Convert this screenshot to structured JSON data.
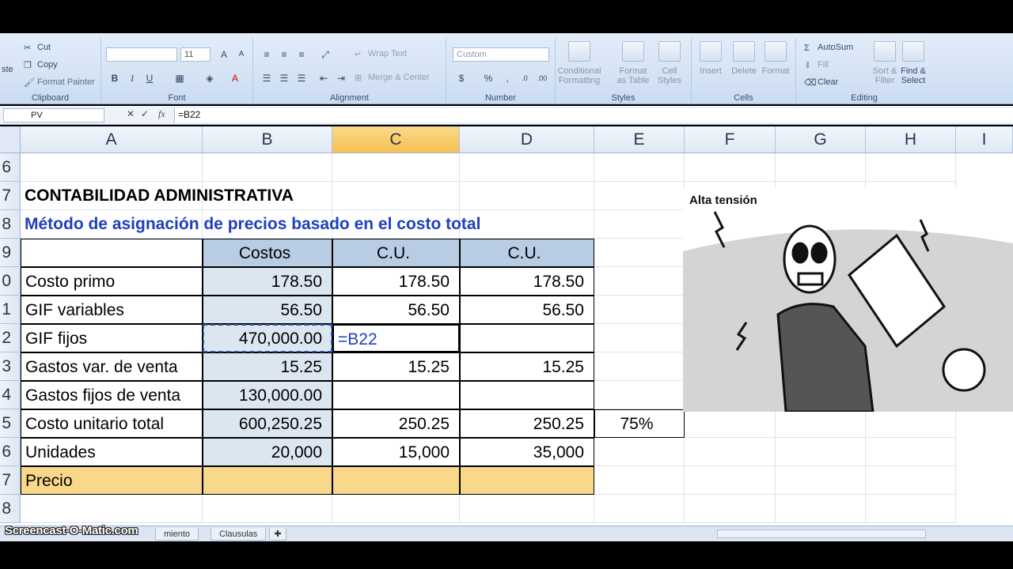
{
  "ribbon": {
    "clipboard": {
      "paste_label": "ste",
      "cut": "Cut",
      "copy": "Copy",
      "format_painter": "Format Painter",
      "group": "Clipboard"
    },
    "font": {
      "size": "11",
      "group": "Font",
      "bold": "B",
      "italic": "I",
      "underline": "U"
    },
    "alignment": {
      "wrap_text": "Wrap Text",
      "merge_center": "Merge & Center",
      "group": "Alignment"
    },
    "number": {
      "format": "Custom",
      "currency": "$",
      "percent": "%",
      "comma": ",",
      "group": "Number"
    },
    "styles": {
      "conditional": "Conditional",
      "conditional2": "Formatting",
      "format_as": "Format",
      "format_as2": "as Table",
      "cell": "Cell",
      "cell2": "Styles",
      "group": "Styles"
    },
    "cells": {
      "insert": "Insert",
      "delete": "Delete",
      "format": "Format",
      "group": "Cells"
    },
    "editing": {
      "autosum": "AutoSum",
      "fill": "Fill",
      "clear": "Clear",
      "sort": "Sort &",
      "sort2": "Filter",
      "find": "Find &",
      "find2": "Select",
      "group": "Editing"
    }
  },
  "formula_bar": {
    "name_box": "PV",
    "fx": "fx",
    "cancel": "✕",
    "enter": "✓",
    "formula": "=B22"
  },
  "columns": [
    "A",
    "B",
    "C",
    "D",
    "E",
    "F",
    "G",
    "H",
    "I"
  ],
  "rows": [
    "6",
    "7",
    "8",
    "9",
    "0",
    "1",
    "2",
    "3",
    "4",
    "5",
    "6",
    "7",
    "8"
  ],
  "sheet": {
    "title": "CONTABILIDAD ADMINISTRATIVA",
    "subtitle": "Método de asignación de precios basado en el costo total",
    "headers": [
      "Costos",
      "C.U.",
      "C.U."
    ],
    "table": [
      {
        "label": "Costo primo",
        "b": "178.50",
        "c": "178.50",
        "d": "178.50",
        "e": ""
      },
      {
        "label": "GIF variables",
        "b": "56.50",
        "c": "56.50",
        "d": "56.50",
        "e": ""
      },
      {
        "label": "GIF fijos",
        "b": "470,000.00",
        "c": "=B22",
        "d": "",
        "e": ""
      },
      {
        "label": "Gastos var. de venta",
        "b": "15.25",
        "c": "15.25",
        "d": "15.25",
        "e": ""
      },
      {
        "label": "Gastos fijos de venta",
        "b": "130,000.00",
        "c": "",
        "d": "",
        "e": ""
      },
      {
        "label": "Costo unitario total",
        "b": "600,250.25",
        "c": "250.25",
        "d": "250.25",
        "e": "75%"
      },
      {
        "label": "Unidades",
        "b": "20,000",
        "c": "15,000",
        "d": "35,000",
        "e": ""
      },
      {
        "label": "Precio",
        "b": "",
        "c": "",
        "d": "",
        "e": ""
      }
    ]
  },
  "cartoon": {
    "caption": "Alta tensión"
  },
  "tabs": {
    "tab1": "miento",
    "tab2": "Clausulas"
  },
  "watermark": "Screencast-O-Matic.com",
  "colors": {
    "header_fill": "#b8cce4",
    "price_fill": "#f9d88a",
    "subtitle": "#1f3fbf",
    "selected_col": "#f5c052"
  }
}
